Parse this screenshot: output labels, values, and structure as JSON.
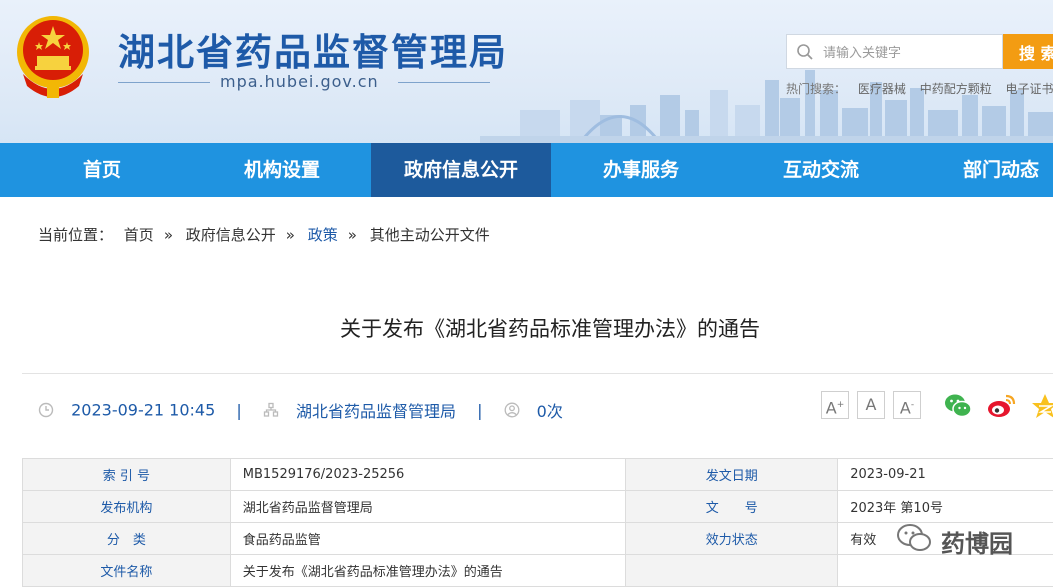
{
  "header": {
    "site_title": "湖北省药品监督管理局",
    "site_url": "mpa.hubei.gov.cn",
    "search_placeholder": "请输入关键字",
    "search_button": "搜 索",
    "hot_label": "热门搜索：",
    "hot_items": [
      "医疗器械",
      "中药配方颗粒",
      "电子证书"
    ]
  },
  "nav": {
    "items": [
      "首页",
      "机构设置",
      "政府信息公开",
      "办事服务",
      "互动交流",
      "部门动态"
    ],
    "active_index": 2,
    "active_color": "#1d5a9c",
    "bar_color": "#1f93e0"
  },
  "breadcrumb": {
    "label": "当前位置：",
    "items": [
      "首页",
      "政府信息公开",
      "政策",
      "其他主动公开文件"
    ],
    "separator": "»"
  },
  "article": {
    "title": "关于发布《湖北省药品标准管理办法》的通告",
    "datetime": "2023-09-21 10:45",
    "publisher": "湖北省药品监督管理局",
    "views": "0次",
    "divider": "|"
  },
  "font_controls": [
    "A+",
    "A",
    "A-"
  ],
  "share_icons": [
    "wechat-icon",
    "weibo-icon",
    "qzone-icon"
  ],
  "info_table": {
    "rows": [
      {
        "l1": "索 引 号",
        "v1": "MB1529176/2023-25256",
        "l2": "发文日期",
        "v2": "2023-09-21"
      },
      {
        "l1": "发布机构",
        "v1": "湖北省药品监督管理局",
        "l2": "文　　号",
        "v2": "2023年 第10号"
      },
      {
        "l1": "分　类",
        "v1": "食品药品监管",
        "l2": "效力状态",
        "v2": "有效"
      },
      {
        "l1": "文件名称",
        "v1": "关于发布《湖北省药品标准管理办法》的通告",
        "l2": "",
        "v2": ""
      }
    ]
  },
  "watermark": {
    "text": "药博园"
  },
  "colors": {
    "brand_blue": "#1e5aa8",
    "search_orange": "#f39c12",
    "link_blue": "#1d5aa8"
  }
}
